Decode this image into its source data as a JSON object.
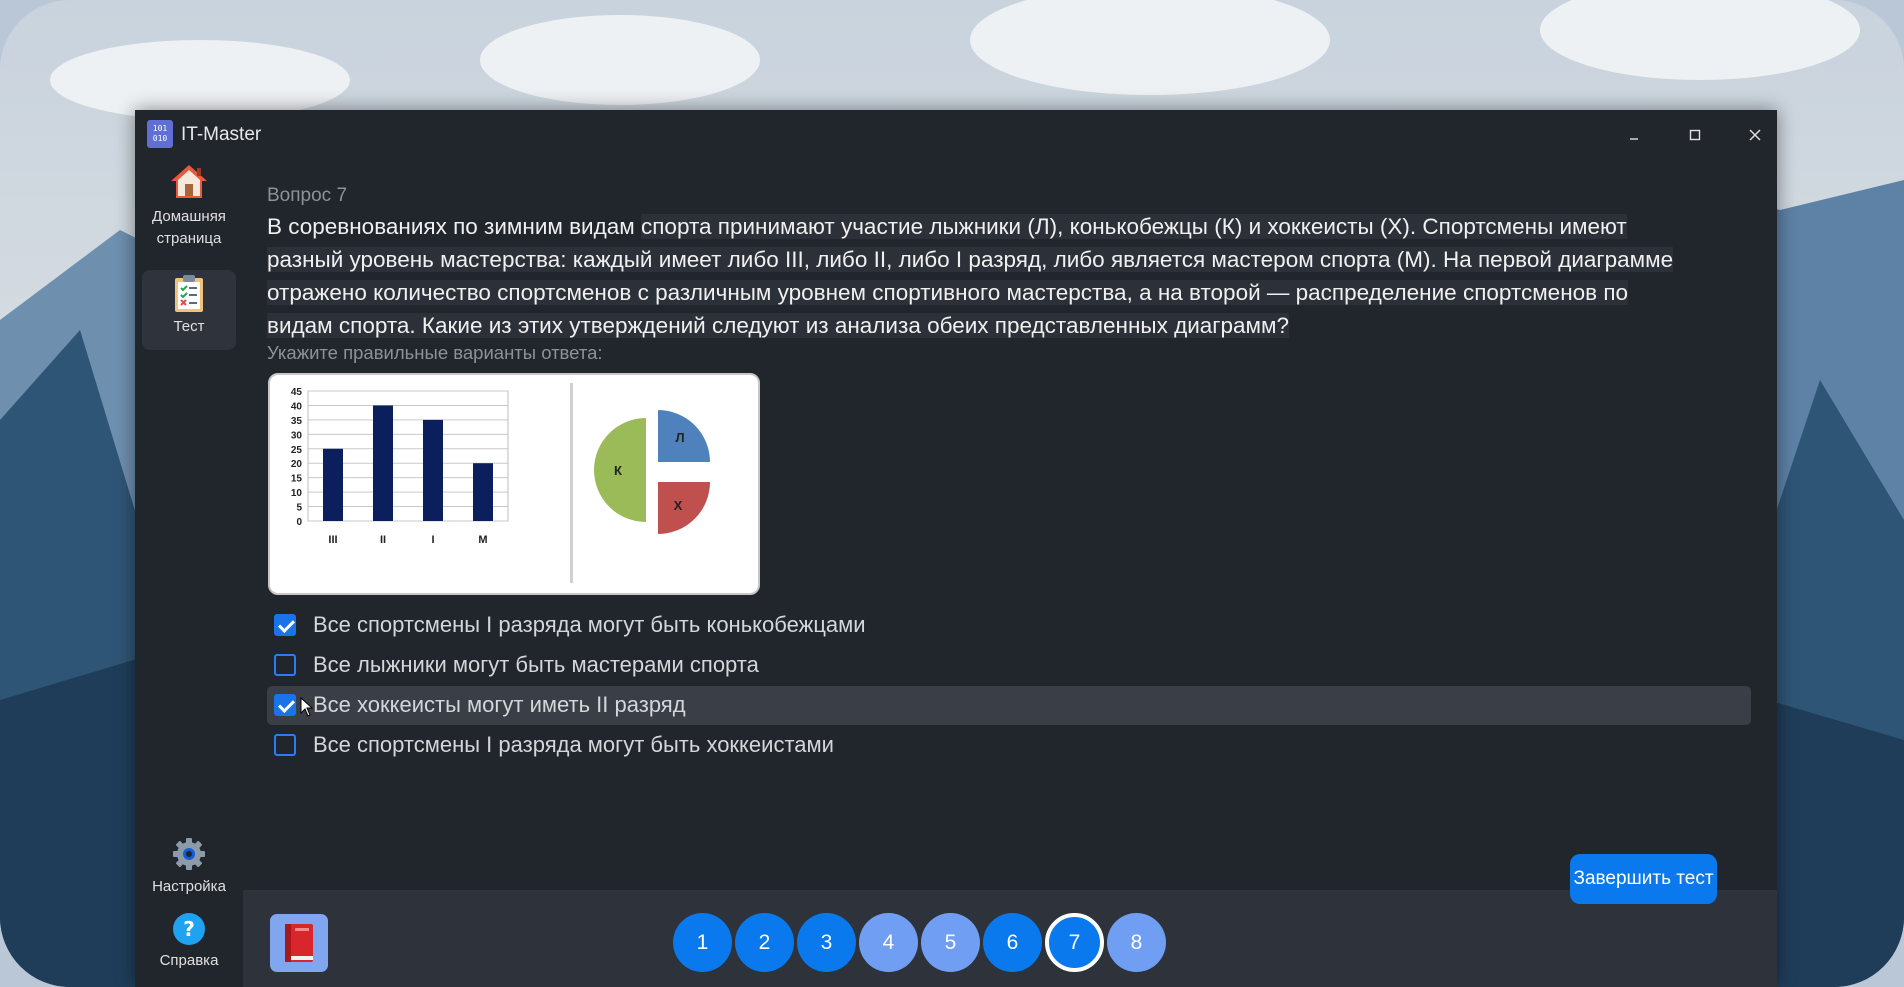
{
  "window": {
    "title": "IT-Master",
    "minimize_icon": "minimize-icon",
    "maximize_icon": "maximize-icon",
    "close_icon": "close-icon"
  },
  "sidebar": {
    "items": [
      {
        "label": "Домашняя страница",
        "icon": "home-icon"
      },
      {
        "label": "Тест",
        "icon": "test-clipboard-icon",
        "active": true
      },
      {
        "label": "Настройка",
        "icon": "gear-icon"
      },
      {
        "label": "Справка",
        "icon": "help-icon"
      }
    ]
  },
  "question": {
    "number_label": "Вопрос 7",
    "text_part1": "В соревнованиях по зимним видам ",
    "text_part2": "спорта принимают участие лыжники (Л), конькобежцы (К) и хоккеисты (Х). Спортсмены имеют разный уровень мастерства: каждый имеет либо III, либо II, либо I разряд, либо является мастером спорта (М). На первой диаграмме отражено количество спортсменов с различным уровнем спортивного мастерства, а на второй — распределение спортсменов по видам спорта. Какие из этих утверждений следуют из анализа обеих представленных диаграмм?",
    "hint": "Укажите правильные варианты ответа:"
  },
  "chart_data": [
    {
      "type": "bar",
      "categories": [
        "III",
        "II",
        "I",
        "M"
      ],
      "values": [
        25,
        40,
        35,
        20
      ],
      "ylim": [
        0,
        45
      ],
      "yticks": [
        "0",
        "5",
        "10",
        "15",
        "20",
        "25",
        "30",
        "35",
        "40",
        "45"
      ],
      "color": "#0a1f5c",
      "grid": true
    },
    {
      "type": "pie",
      "labels": [
        "К",
        "Л",
        "Х"
      ],
      "values": [
        50,
        25,
        25
      ],
      "colors": [
        "#9bbb59",
        "#4f81bd",
        "#c0504d"
      ],
      "exploded": true
    }
  ],
  "options": [
    {
      "label": "Все спортсмены I разряда могут быть конькобежцами",
      "checked": true
    },
    {
      "label": "Все лыжники могут быть мастерами спорта",
      "checked": false
    },
    {
      "label": "Все хоккеисты могут иметь II разряд",
      "checked": true
    },
    {
      "label": "Все спортсмены I разряда могут быть хоккеистами",
      "checked": false
    }
  ],
  "pagination": {
    "pages": [
      "1",
      "2",
      "3",
      "4",
      "5",
      "6",
      "7",
      "8"
    ],
    "current": "7",
    "colors": {
      "answered": "#0a79ee",
      "unanswered": "#6f9ef3"
    }
  },
  "book_icon": "book-icon",
  "finish_label": "Завершить тест"
}
